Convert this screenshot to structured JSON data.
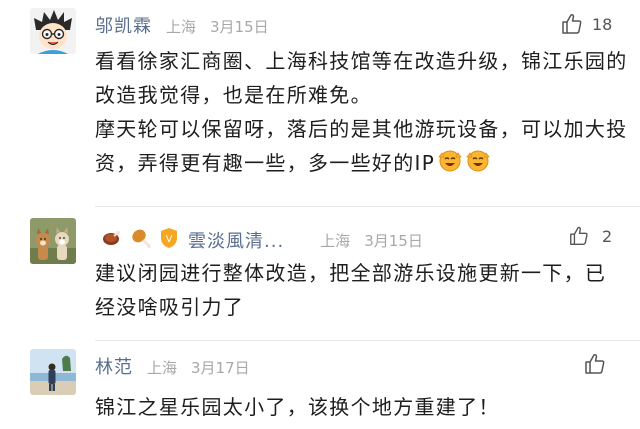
{
  "comments": [
    {
      "username": "邬凯霖",
      "location": "上海",
      "date": "3月15日",
      "likes": "18",
      "paragraphs": [
        "看看徐家汇商圈、上海科技馆等在改造升级，锦江乐园的改造我觉得，也是在所难免。",
        "摩天轮可以保留呀，落后的是其他游玩设备，可以加大投资，弄得更有趣一些，多一些好的IP"
      ],
      "avatar_icon": "cartoon-boy-avatar",
      "emoji_icons": [
        "cheering-face-emoji",
        "cheering-face-emoji"
      ]
    },
    {
      "username": "雲淡風清...",
      "location": "上海",
      "date": "3月15日",
      "likes": "2",
      "paragraphs": [
        "建议闭园进行整体改造，把全部游乐设施更新一下，已经没啥吸引力了"
      ],
      "avatar_icon": "two-dogs-photo-avatar",
      "badge_icons": [
        "roast-meat-badge-icon",
        "drumstick-badge-icon",
        "level-shield-badge-icon"
      ]
    },
    {
      "username": "林范",
      "location": "上海",
      "date": "3月17日",
      "likes": "",
      "paragraphs": [
        "锦江之星乐园太小了，该换个地方重建了！"
      ],
      "avatar_icon": "seaside-person-photo-avatar"
    }
  ],
  "colors": {
    "username": "#5a6f8f",
    "meta": "#a8a8a8",
    "body": "#1e1e1e",
    "divider": "#e6e6e6"
  }
}
